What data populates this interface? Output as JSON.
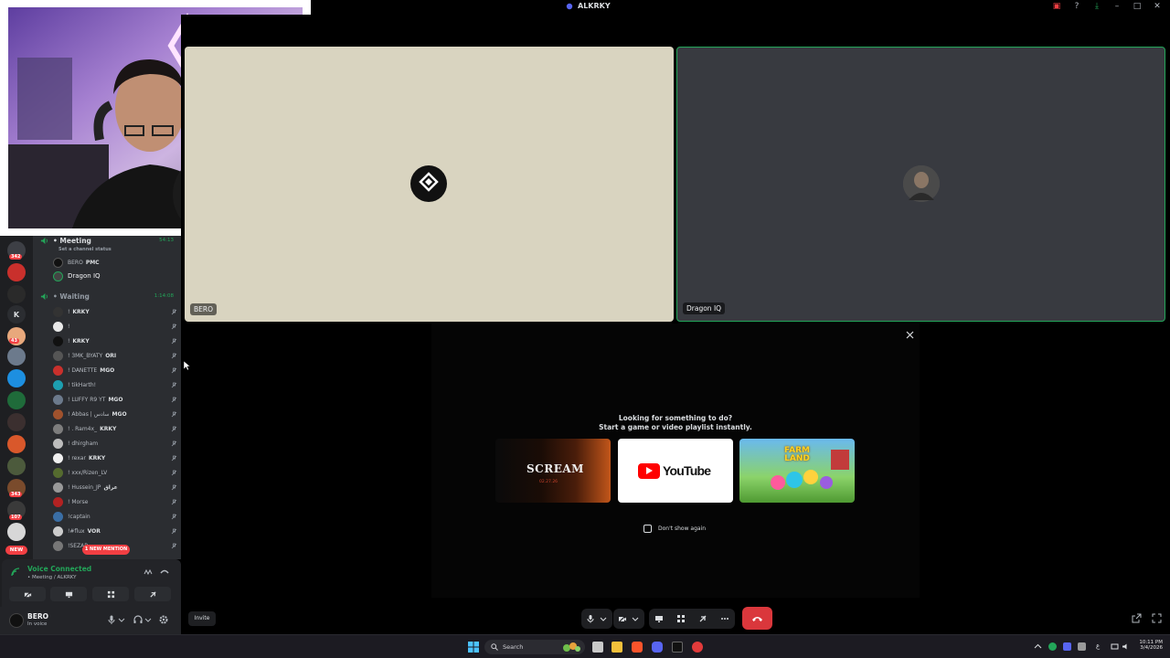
{
  "window": {
    "title": "ALKRKY",
    "icons": [
      "screen-share-icon",
      "help-icon",
      "download-icon",
      "minimize-icon",
      "maximize-icon",
      "close-icon"
    ]
  },
  "colors": {
    "accent_green": "#23a559",
    "danger_red": "#da373c",
    "mention_red": "#f23f43",
    "discord_blurple": "#5865f2",
    "sidebar_bg": "#2b2d31",
    "rail_bg": "#1e1f22"
  },
  "rail": {
    "badges": [
      "342",
      "43",
      "343",
      "107"
    ],
    "letter_server": "K",
    "new_badge": "NEW"
  },
  "channels": {
    "meeting": {
      "name": "• Meeting",
      "time": "54:13",
      "status_placeholder": "Set a channel status",
      "members": [
        {
          "name": "BERO",
          "tag": "PMC"
        },
        {
          "name": "Dragon IQ",
          "tag": ""
        }
      ]
    },
    "waiting": {
      "name": "• Waiting",
      "time": "1:14:08",
      "members": [
        {
          "name": "!",
          "tag": "KRKY"
        },
        {
          "name": "!",
          "tag": ""
        },
        {
          "name": "!",
          "tag": "KRKY"
        },
        {
          "name": "! 3MK_BYATY",
          "tag": "ORI"
        },
        {
          "name": "! DANETTE",
          "tag": "MGO"
        },
        {
          "name": "! tikHarth!",
          "tag": ""
        },
        {
          "name": "! LUFFY R9 YT",
          "tag": "MGO"
        },
        {
          "name": "! Abbas | سادس",
          "tag": "MGO"
        },
        {
          "name": "! . Ram4x_",
          "tag": "KRKY"
        },
        {
          "name": "! dhirgham",
          "tag": ""
        },
        {
          "name": "! rexar",
          "tag": "KRKY"
        },
        {
          "name": "! xxx/Rizen_LV",
          "tag": ""
        },
        {
          "name": "! Hussein_JP",
          "tag": "عراق"
        },
        {
          "name": "! Morse",
          "tag": ""
        },
        {
          "name": "!captain",
          "tag": ""
        },
        {
          "name": "!#flux",
          "tag": "VOR"
        },
        {
          "name": "!SEZAR",
          "tag": ""
        }
      ]
    },
    "mention_pill": "1 NEW MENTION"
  },
  "voice_panel": {
    "status": "Voice Connected",
    "location": "• Meeting / ALKRKY"
  },
  "user_panel": {
    "name": "BERO",
    "status": "In voice"
  },
  "stage": {
    "tiles": [
      {
        "label": "BERO",
        "bg": "#d9d4c0"
      },
      {
        "label": "Dragon IQ",
        "bg": "#383a40"
      }
    ],
    "activity": {
      "title": "Looking for something to do?",
      "subtitle": "Start a game or video playlist instantly.",
      "cards": [
        {
          "name": "SCREAM",
          "date": "02.27.26"
        },
        {
          "name": "YouTube"
        },
        {
          "name": "FARM LAND"
        }
      ],
      "dont_show": "Don't show again"
    },
    "invite_label": "Invite"
  },
  "taskbar": {
    "search_label": "Search",
    "time": "10:11 PM",
    "date": "3/4/2026"
  }
}
